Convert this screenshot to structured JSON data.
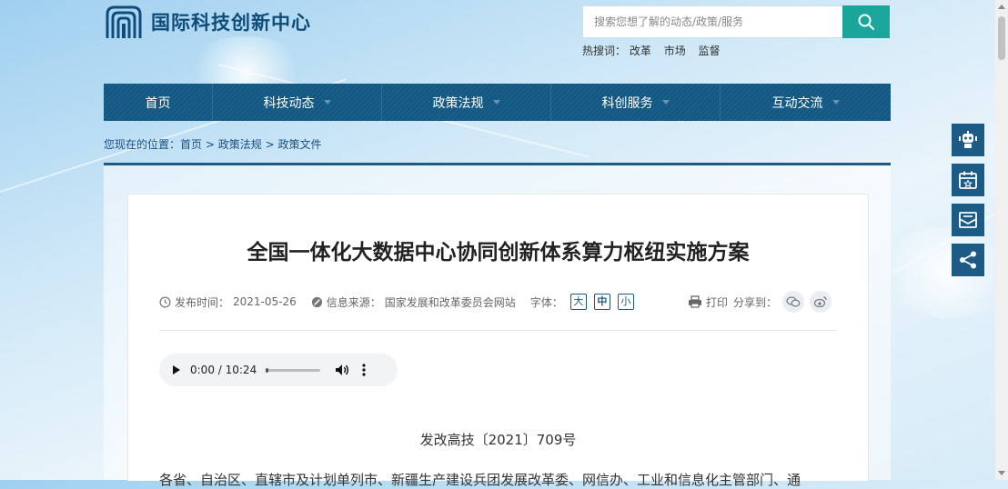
{
  "header": {
    "site_name": "国际科技创新中心",
    "search_placeholder": "搜索您想了解的动态/政策/服务",
    "hot_label": "热搜词：",
    "hot_words": [
      "改革",
      "市场",
      "监督"
    ]
  },
  "nav": {
    "items": [
      {
        "label": "首页",
        "dropdown": false
      },
      {
        "label": "科技动态",
        "dropdown": true
      },
      {
        "label": "政策法规",
        "dropdown": true
      },
      {
        "label": "科创服务",
        "dropdown": true
      },
      {
        "label": "互动交流",
        "dropdown": true
      }
    ]
  },
  "breadcrumb": {
    "prefix": "您现在的位置：",
    "items": [
      "首页",
      "政策法规",
      "政策文件"
    ],
    "separator": ">"
  },
  "article": {
    "title": "全国一体化大数据中心协同创新体系算力枢纽实施方案",
    "publish_label": "发布时间：",
    "publish_date": "2021-05-26",
    "source_label": "信息来源：",
    "source": "国家发展和改革委员会网站",
    "font_label": "字体：",
    "font_sizes": [
      "大",
      "中",
      "小"
    ],
    "print_label": "打印",
    "share_label": "分享到：",
    "audio_time": "0:00 / 10:24",
    "doc_number": "发改高技〔2021〕709号",
    "first_line": "各省、自治区、直辖市及计划单列市、新疆生产建设兵团发展改革委、网信办、工业和信息化主管部门、通"
  },
  "colors": {
    "nav_bg": "#18608c",
    "search_button": "#1aa79a",
    "brand": "#0f4c7a"
  },
  "float_icons": [
    "robot-icon",
    "calendar-icon",
    "mail-icon",
    "share-icon"
  ]
}
